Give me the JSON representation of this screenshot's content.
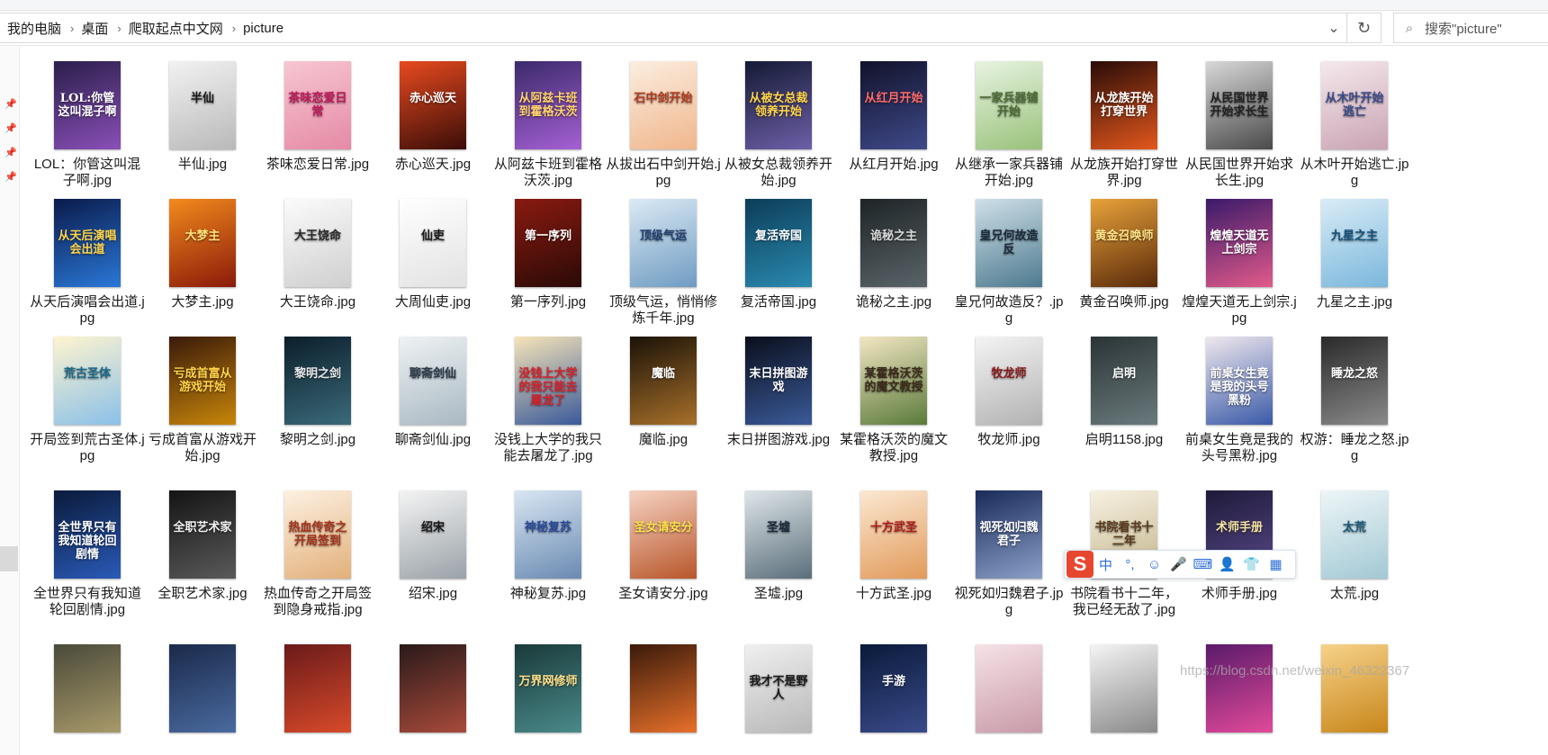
{
  "window": {
    "breadcrumb": [
      "我的电脑",
      "桌面",
      "爬取起点中文网",
      "picture"
    ],
    "search_placeholder": "搜索\"picture\"",
    "ime_logo": "S",
    "ime_mode": "中",
    "watermark": "https://blog.csdn.net/weixin_46322367"
  },
  "files": [
    {
      "name": "LOL：你管这叫混子啊.jpg",
      "c1": "#2a1f4a",
      "c2": "#8a4fb8",
      "title": "LOL:你管这叫混子啊",
      "tc": "#ffffff"
    },
    {
      "name": "半仙.jpg",
      "c1": "#f2f2f2",
      "c2": "#b9b9b9",
      "title": "半仙",
      "tc": "#1b1b1b"
    },
    {
      "name": "茶味恋爱日常.jpg",
      "c1": "#f7c6d2",
      "c2": "#e58aa6",
      "title": "茶味恋爱日常",
      "tc": "#c2185b"
    },
    {
      "name": "赤心巡天.jpg",
      "c1": "#e84a1f",
      "c2": "#3a0d08",
      "title": "赤心巡天",
      "tc": "#ffffff"
    },
    {
      "name": "从阿兹卡班到霍格沃茨.jpg",
      "c1": "#3b2a6b",
      "c2": "#a560d4",
      "title": "从阿兹卡班到霍格沃茨",
      "tc": "#ffd36b"
    },
    {
      "name": "从拔出石中剑开始.jpg",
      "c1": "#fbeee0",
      "c2": "#f0b68c",
      "title": "石中剑开始",
      "tc": "#b23a1c"
    },
    {
      "name": "从被女总裁领养开始.jpg",
      "c1": "#141a34",
      "c2": "#6d5fa8",
      "title": "从被女总裁领养开始",
      "tc": "#ffd54a"
    },
    {
      "name": "从红月开始.jpg",
      "c1": "#11122a",
      "c2": "#3f4a8a",
      "title": "从红月开始",
      "tc": "#ff6b6b"
    },
    {
      "name": "从继承一家兵器铺开始.jpg",
      "c1": "#e8f3e1",
      "c2": "#98c27a",
      "title": "一家兵器铺开始",
      "tc": "#4d6b34"
    },
    {
      "name": "从龙族开始打穿世界.jpg",
      "c1": "#2a0c08",
      "c2": "#e3571c",
      "title": "从龙族开始打穿世界",
      "tc": "#ffffff"
    },
    {
      "name": "从民国世界开始求长生.jpg",
      "c1": "#d8d8d8",
      "c2": "#4a4a4a",
      "title": "从民国世界开始求长生",
      "tc": "#222222"
    },
    {
      "name": "从木叶开始逃亡.jpg",
      "c1": "#f5e9ec",
      "c2": "#c9a3b3",
      "title": "从木叶开始逃亡",
      "tc": "#3a4a8a"
    },
    {
      "name": "从天后演唱会出道.jpg",
      "c1": "#0a1a4a",
      "c2": "#2a78d8",
      "title": "从天后演唱会出道",
      "tc": "#ffd44a"
    },
    {
      "name": "大梦主.jpg",
      "c1": "#f28a1c",
      "c2": "#8a1a0a",
      "title": "大梦主",
      "tc": "#ffe27a"
    },
    {
      "name": "大王饶命.jpg",
      "c1": "#fbfbfb",
      "c2": "#cfcfcf",
      "title": "大王饶命",
      "tc": "#2a2a2a"
    },
    {
      "name": "大周仙吏.jpg",
      "c1": "#ffffff",
      "c2": "#e2e2e2",
      "title": "仙吏",
      "tc": "#1a1a1a"
    },
    {
      "name": "第一序列.jpg",
      "c1": "#8a1a10",
      "c2": "#2a0a06",
      "title": "第一序列",
      "tc": "#ffffff"
    },
    {
      "name": "顶级气运，悄悄修炼千年.jpg",
      "c1": "#dbe9f4",
      "c2": "#6f9cc2",
      "title": "顶级气运",
      "tc": "#1f3f6f"
    },
    {
      "name": "复活帝国.jpg",
      "c1": "#0c3d58",
      "c2": "#2a8ab0",
      "title": "复活帝国",
      "tc": "#ffffff"
    },
    {
      "name": "诡秘之主.jpg",
      "c1": "#1e2426",
      "c2": "#5a6468",
      "title": "诡秘之主",
      "tc": "#d8d8d8"
    },
    {
      "name": "皇兄何故造反？.jpg",
      "c1": "#cfe0e8",
      "c2": "#4d7a8f",
      "title": "皇兄何故造反",
      "tc": "#1a2a3a"
    },
    {
      "name": "黄金召唤师.jpg",
      "c1": "#e8a23a",
      "c2": "#5a2a0a",
      "title": "黄金召唤师",
      "tc": "#ffe48a"
    },
    {
      "name": "煌煌天道无上剑宗.jpg",
      "c1": "#3a1a6a",
      "c2": "#e25a8a",
      "title": "煌煌天道无上剑宗",
      "tc": "#ffffff"
    },
    {
      "name": "九星之主.jpg",
      "c1": "#d9ecf6",
      "c2": "#7ab7dc",
      "title": "九星之主",
      "tc": "#15507a"
    },
    {
      "name": "开局签到荒古圣体.jpg",
      "c1": "#fff4cf",
      "c2": "#8ac0e8",
      "title": "荒古圣体",
      "tc": "#1a6a8a"
    },
    {
      "name": "亏成首富从游戏开始.jpg",
      "c1": "#3a1a0a",
      "c2": "#c8860a",
      "title": "亏成首富从游戏开始",
      "tc": "#ffd44a"
    },
    {
      "name": "黎明之剑.jpg",
      "c1": "#0c1e2a",
      "c2": "#3a6a7a",
      "title": "黎明之剑",
      "tc": "#e8e8e8"
    },
    {
      "name": "聊斋剑仙.jpg",
      "c1": "#eef2f4",
      "c2": "#a9b8c2",
      "title": "聊斋剑仙",
      "tc": "#2a3a4a"
    },
    {
      "name": "没钱上大学的我只能去屠龙了.jpg",
      "c1": "#f6e4b8",
      "c2": "#3a5a9a",
      "title": "没钱上大学的我只能去屠龙了",
      "tc": "#d8212a"
    },
    {
      "name": "魔临.jpg",
      "c1": "#1a1208",
      "c2": "#a8702a",
      "title": "魔临",
      "tc": "#ffffff"
    },
    {
      "name": "末日拼图游戏.jpg",
      "c1": "#0a0e1a",
      "c2": "#3a5a9a",
      "title": "末日拼图游戏",
      "tc": "#ffffff"
    },
    {
      "name": "某霍格沃茨的魔文教授.jpg",
      "c1": "#f2e6c2",
      "c2": "#5a7a3a",
      "title": "某霍格沃茨的魔文教授",
      "tc": "#3a2a1a"
    },
    {
      "name": "牧龙师.jpg",
      "c1": "#f4f4f4",
      "c2": "#b2b2b2",
      "title": "牧龙师",
      "tc": "#8a1a1a"
    },
    {
      "name": "启明1158.jpg",
      "c1": "#2a3436",
      "c2": "#6a7a7c",
      "title": "启明",
      "tc": "#ffffff"
    },
    {
      "name": "前桌女生竟是我的头号黑粉.jpg",
      "c1": "#f0e8ee",
      "c2": "#3a5aa8",
      "title": "前桌女生竟是我的头号黑粉",
      "tc": "#ffffff"
    },
    {
      "name": "权游：睡龙之怒.jpg",
      "c1": "#2a2a2a",
      "c2": "#8a8a8a",
      "title": "睡龙之怒",
      "tc": "#ffffff"
    },
    {
      "name": "全世界只有我知道轮回剧情.jpg",
      "c1": "#0a1a3a",
      "c2": "#2a5ab8",
      "title": "全世界只有我知道轮回剧情",
      "tc": "#ffffff"
    },
    {
      "name": "全职艺术家.jpg",
      "c1": "#141414",
      "c2": "#5a5a5a",
      "title": "全职艺术家",
      "tc": "#f0f0f0"
    },
    {
      "name": "热血传奇之开局签到隐身戒指.jpg",
      "c1": "#fdf1e2",
      "c2": "#e2b07a",
      "title": "热血传奇之开局签到",
      "tc": "#a8321a"
    },
    {
      "name": "绍宋.jpg",
      "c1": "#f4f4f4",
      "c2": "#9aa2a8",
      "title": "绍宋",
      "tc": "#1a1a1a"
    },
    {
      "name": "神秘复苏.jpg",
      "c1": "#d8e6f2",
      "c2": "#6a8ab2",
      "title": "神秘复苏",
      "tc": "#2a4a9a"
    },
    {
      "name": "圣女请安分.jpg",
      "c1": "#f6d2c2",
      "c2": "#b8562a",
      "title": "圣女请安分",
      "tc": "#ffe04a"
    },
    {
      "name": "圣墟.jpg",
      "c1": "#dfe6ea",
      "c2": "#5a6e7a",
      "title": "圣墟",
      "tc": "#1a2a3a"
    },
    {
      "name": "十方武圣.jpg",
      "c1": "#fbe8d2",
      "c2": "#e29a5a",
      "title": "十方武圣",
      "tc": "#b21a1a"
    },
    {
      "name": "视死如归魏君子.jpg",
      "c1": "#1a2a5a",
      "c2": "#8aa0c8",
      "title": "视死如归魏君子",
      "tc": "#ffffff"
    },
    {
      "name": "书院看书十二年，我已经无敌了.jpg",
      "c1": "#f7f1e2",
      "c2": "#c2b48a",
      "title": "书院看书十二年",
      "tc": "#5a3a1a"
    },
    {
      "name": "术师手册.jpg",
      "c1": "#1e1a3a",
      "c2": "#5a4a8a",
      "title": "术师手册",
      "tc": "#f6e6a2"
    },
    {
      "name": "太荒.jpg",
      "c1": "#eef6f8",
      "c2": "#a2c8d4",
      "title": "太荒",
      "tc": "#1a5a7a"
    },
    {
      "name": "",
      "c1": "#4a4a3a",
      "c2": "#a89a6a",
      "title": "",
      "tc": "#ffffff"
    },
    {
      "name": "",
      "c1": "#1a2a4a",
      "c2": "#4a6aa0",
      "title": "",
      "tc": "#ffffff"
    },
    {
      "name": "",
      "c1": "#6a1a1a",
      "c2": "#d84a2a",
      "title": "",
      "tc": "#ffffff"
    },
    {
      "name": "",
      "c1": "#2a1a1a",
      "c2": "#a84a3a",
      "title": "",
      "tc": "#ffffff"
    },
    {
      "name": "",
      "c1": "#1a3a3a",
      "c2": "#4a8a8a",
      "title": "万界网修师",
      "tc": "#ffe08a"
    },
    {
      "name": "",
      "c1": "#3a1a0a",
      "c2": "#e8702a",
      "title": "",
      "tc": "#ffffff"
    },
    {
      "name": "",
      "c1": "#f0f0f0",
      "c2": "#b8b8b8",
      "title": "我才不是野人",
      "tc": "#1a1a1a"
    },
    {
      "name": "",
      "c1": "#0a1a3a",
      "c2": "#3a4a8a",
      "title": "手游",
      "tc": "#ffffff"
    },
    {
      "name": "",
      "c1": "#f6e2e6",
      "c2": "#c89aa8",
      "title": "",
      "tc": "#ffffff"
    },
    {
      "name": "",
      "c1": "#f4f4f4",
      "c2": "#8a8a8a",
      "title": "",
      "tc": "#1a1a1a"
    },
    {
      "name": "",
      "c1": "#5a1a6a",
      "c2": "#e24a9a",
      "title": "",
      "tc": "#ffffff"
    },
    {
      "name": "",
      "c1": "#f6d28a",
      "c2": "#c8861a",
      "title": "",
      "tc": "#ffffff"
    }
  ]
}
